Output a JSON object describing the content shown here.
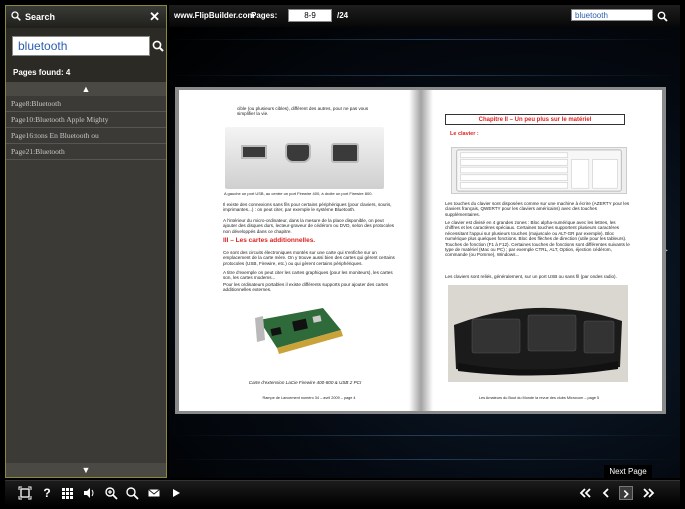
{
  "search_panel": {
    "title": "Search",
    "close_symbol": "✕",
    "query": "bluetooth",
    "found_text": "Pages found: 4",
    "results": [
      "Page8:Bluetooth",
      "Page10:Bluetooth Apple Mighty",
      "Page16:tons En Bluetooth ou",
      "Page21:Bluetooth"
    ],
    "up_arrow": "▲",
    "down_arrow": "▼"
  },
  "topbar": {
    "site": "www.FlipBuilder.com",
    "pages_label": "Pages:",
    "current_pages": "8-9",
    "total_pages": "/24",
    "search_value": "bluetooth"
  },
  "book": {
    "left_page": {
      "intro": "cible (ou plusieurs cibles), différent des autres, pour ne pas vous simplifier la vie.",
      "ports_caption": "A gauche un port USB, au centre un port Firewire 400, à droite un port Firewire 800.",
      "connections_text": "Il existe des connexions sans fils pour certains périphériques (pour claviers, souris, imprimantes...) : on peut citer, par exemple le système Bluetooth.",
      "inside_text": "A l'intérieur du micro-ordinateur, dans la mesure de la place disponible, on peut ajouter des disques durs, lecteur-graveur de cédérom ou DVD, selon des protocoles non développés dans ce chapitre.",
      "section_heading": "III – Les cartes additionnelles.",
      "section_text": "Ce sont des circuits électroniques montés sur une carte qui s'enfiche sur un emplacement de la carte mère. On y trouve aussi bien des cartes qui gèrent certains protocoles (USB, Firewire, etc.) ou qui gèrent certains périphériques.",
      "example_text": "A titre d'exemple on peut citer les cartes graphiques (pour les moniteurs), les cartes son, les cartes modems...",
      "laptop_text": "Pour les ordinateurs portables il existe différents supports pour ajouter des cartes additionnelles externes.",
      "card_caption": "Carte d'extension LaCie Firewire 400-800 & USB 2 PCI",
      "footer": "Rampe de Lancement numéro 34 – avril 2009 – page 4"
    },
    "right_page": {
      "chapter_title": "Chapitre II – Un peu plus sur le matériel",
      "keyboard_heading": "Le clavier :",
      "keyboard_intro": "Les touches du clavier sont disposées comme sur une machine à écrire (AZERTY pour les claviers français, QWERTY pour les claviers américains) avec des touches supplémentaires.",
      "zones_text": "Le clavier est divisé en 4 grandes zones : Bloc alpha-numérique avec les lettres, les chiffres et les caractères spéciaux. Certaines touches supportent plusieurs caractères nécessitant l'appui sur plusieurs touches (majuscule ou ALT-GR par exemple). Bloc numérique plus quelques fonctions. Bloc des flèches de direction (utile pour les tableurs). Touches de fonction (F1 à F12). Certaines touches de fonctions sont différentes suivants le type de matériel (Mac ou PC) ; par exemple CTRL, ALT, Option, éjection cédérom, commande (ou Pomme), Windows...",
      "cables_text": "Les claviers sont reliés, généralement, sur un port USB ou sans fil (par ondes radio).",
      "footer": "Les Amateurs du Bout du Monde la revue des clubs Microcom – page 5"
    }
  },
  "tooltip": "Next Page",
  "toolbar_icons": [
    "fit-icon",
    "help-icon",
    "thumbnails-icon",
    "sound-icon",
    "zoom-in-icon",
    "search-icon",
    "email-icon",
    "autoplay-icon",
    "first-page-icon",
    "prev-page-icon",
    "next-page-icon",
    "last-page-icon"
  ],
  "colors": {
    "panel_border": "#8c8a3a",
    "accent_red": "#dd2222",
    "search_text": "#2a5fb0"
  }
}
